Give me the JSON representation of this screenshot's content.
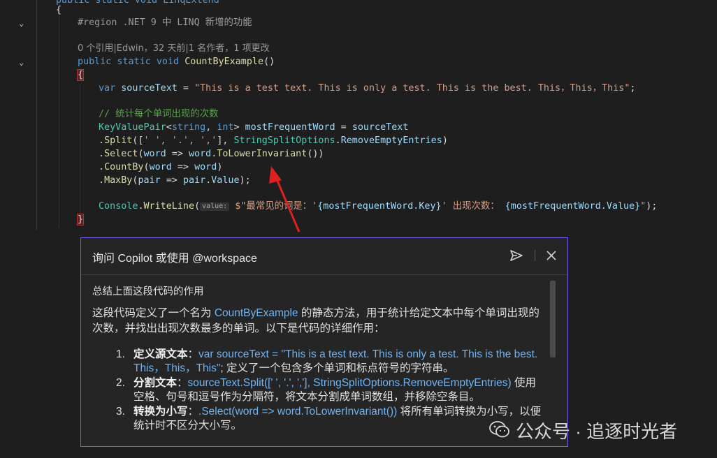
{
  "editor": {
    "lines": {
      "l0_text": "public static void LinqExtend",
      "l1_brace": "{",
      "region": "#region .NET 9 中 LINQ 新增的功能",
      "codelens": "0 个引用|Edwin，32 天前|1 名作者，1 项更改",
      "sig_kw": "public static void",
      "sig_name": "CountByExample",
      "sig_parens": "()",
      "open_brace": "{",
      "l_var_kw": "var",
      "l_var_name": "sourceText",
      "l_var_eq": " = ",
      "l_var_str": "\"This is a test text. This is only a test. This is the best. This，This，This\"",
      "l_var_end": ";",
      "comment": "// 统计每个单词出现的次数",
      "kvp_type": "KeyValuePair",
      "kvp_generic_open": "<",
      "kvp_t1": "string",
      "kvp_comma": ", ",
      "kvp_t2": "int",
      "kvp_generic_close": ">",
      "kvp_var": " mostFrequentWord",
      "kvp_eq": " = ",
      "kvp_src": "sourceText",
      "split_dot": ".",
      "split_m": "Split",
      "split_args_a": "([",
      "split_chars": "' ', '.', ','",
      "split_args_b": "], ",
      "split_opt_t": "StringSplitOptions",
      "split_opt_dot": ".",
      "split_opt_v": "RemoveEmptyEntries",
      "split_close": ")",
      "sel_dot": ".",
      "sel_m": "Select",
      "sel_a": "(",
      "sel_p": "word",
      "sel_arrow": " => ",
      "sel_p2": "word",
      "sel_dot2": ".",
      "sel_m2": "ToLowerInvariant",
      "sel_end": "())",
      "cb_dot": ".",
      "cb_m": "CountBy",
      "cb_a": "(",
      "cb_p": "word",
      "cb_arrow": " => ",
      "cb_p2": "word",
      "cb_end": ")",
      "mb_dot": ".",
      "mb_m": "MaxBy",
      "mb_a": "(",
      "mb_p": "pair",
      "mb_arrow": " => ",
      "mb_p2": "pair",
      "mb_dot2": ".",
      "mb_v": "Value",
      "mb_end": ");",
      "con_t": "Console",
      "con_dot": ".",
      "con_m": "WriteLine",
      "con_a": "(",
      "con_hint": "value:",
      "con_s1": " $\"最常见的词是：'",
      "con_i1": "{mostFrequentWord.Key}",
      "con_s2": "' 出现次数： ",
      "con_i2": "{mostFrequentWord.Value}",
      "con_s3": "\"",
      "con_end": ");",
      "close_brace": "}"
    }
  },
  "copilot": {
    "title": "询问 Copilot 或使用 @workspace",
    "send_icon": "send-icon",
    "close_icon": "close-icon",
    "user_message": "总结上面这段代码的作用",
    "resp_a": "这段代码定义了一个名为 ",
    "resp_link": "CountByExample",
    "resp_b": " 的静态方法，用于统计给定文本中每个单词出现的次数，并找出出现次数最多的单词。以下是代码的详细作用：",
    "items": [
      {
        "num": "1.",
        "title": "定义源文本",
        "colon": "：",
        "code": "var sourceText = \"This is a test text. This is only a test. This is the best. This，This，This\"",
        "desc": "; 定义了一个包含多个单词和标点符号的字符串。"
      },
      {
        "num": "2.",
        "title": "分割文本",
        "colon": "：",
        "code": "sourceText.Split([' ', '.', ','], StringSplitOptions.RemoveEmptyEntries)",
        "desc": " 使用空格、句号和逗号作为分隔符，将文本分割成单词数组，并移除空条目。"
      },
      {
        "num": "3.",
        "title": "转换为小写",
        "colon": "：",
        "code": ".Select(word => word.ToLowerInvariant())",
        "desc": " 将所有单词转换为小写，以便统计时不区分大小写。"
      }
    ]
  },
  "watermark": {
    "text": "公众号 · 追逐时光者",
    "icon": "wechat-icon"
  },
  "colors": {
    "editor_bg": "#1e1e1e",
    "panel_border": "#7160e8",
    "arrow": "#e02020"
  }
}
